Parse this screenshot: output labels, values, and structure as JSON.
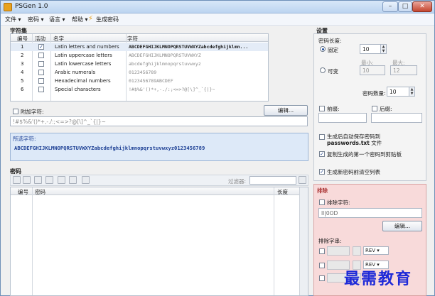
{
  "window": {
    "title": "PSGen 1.0",
    "min_glyph": "–",
    "max_glyph": "□",
    "close_glyph": "✕"
  },
  "menu": {
    "file": "文件 ▾",
    "password": "密码 ▾",
    "language": "语言 ▾",
    "help": "帮助 ▾",
    "generate": "生成密码"
  },
  "charset": {
    "heading": "字符集",
    "columns": [
      "编号",
      "活动",
      "名字",
      "字符"
    ],
    "rows": [
      {
        "num": "1",
        "active": true,
        "name": "Latin letters and numbers",
        "chars": "ABCDEFGHIJKLMNOPQRSTUVWXYZabcdefghijklmn..."
      },
      {
        "num": "2",
        "active": false,
        "name": "Latin uppercase letters",
        "chars": "ABCDEFGHIJKLMNOPQRSTUVWXYZ"
      },
      {
        "num": "3",
        "active": false,
        "name": "Latin lowercase letters",
        "chars": "abcdefghijklmnopqrstuvwxyz"
      },
      {
        "num": "4",
        "active": false,
        "name": "Arabic numerals",
        "chars": "0123456789"
      },
      {
        "num": "5",
        "active": false,
        "name": "Hexadecimal numbers",
        "chars": "0123456789ABCDEF"
      },
      {
        "num": "6",
        "active": false,
        "name": "Special characters",
        "chars": "!#$%&'()*+,-./:;<=>?@[\\]^_`{|}~"
      }
    ],
    "additional_label": "附加字符:",
    "edit_button": "编辑...",
    "additional_value": "!#$%&'()*+,-./:;<=>?@[\\]^_`{|}~",
    "selected_label": "所选字符:",
    "selected_value": "ABCDEFGHIJKLMNOPQRSTUVWXYZabcdefghijklmnopqrstuvwxyz0123456789"
  },
  "passwords": {
    "heading": "密码",
    "filter_label": "过滤器:",
    "columns": [
      "编号",
      "密码",
      "长度"
    ]
  },
  "settings": {
    "heading": "设置",
    "length_label": "密码长度:",
    "fixed_label": "固定",
    "fixed_value": "10",
    "min_label": "最小:",
    "max_label": "最大:",
    "variable_label": "可变",
    "min_value": "10",
    "max_value": "12",
    "count_label": "密码数量:",
    "count_value": "10",
    "prefix_label": "前缀:",
    "suffix_label": "后缀:",
    "autosave_label": "生成后自动保存密码到 passwords.txt 文件",
    "autosave_bold": "passwords.txt",
    "copy_label": "复制生成的第一个密码到剪贴板",
    "clear_label": "生成新密码前清空列表"
  },
  "exclude": {
    "heading": "排除",
    "chars_label": "排除字符:",
    "chars_value": "Il|0OD",
    "edit_button": "编辑...",
    "strings_label": "排除字串:",
    "rev_label": "REV"
  },
  "watermark": "最需教育"
}
